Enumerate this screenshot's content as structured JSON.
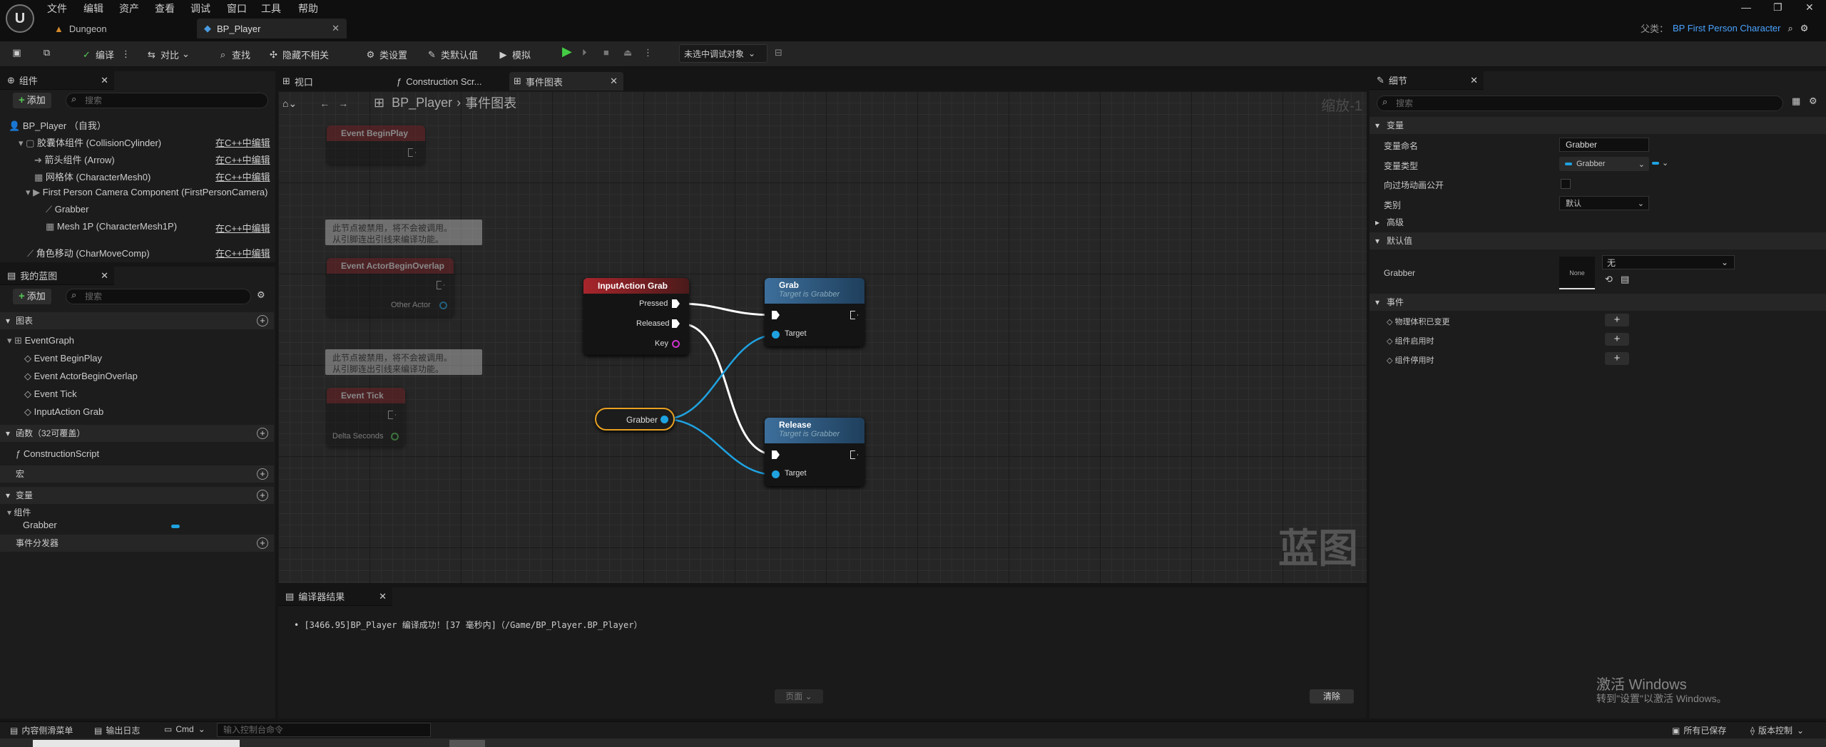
{
  "menu": [
    "文件",
    "编辑",
    "资产",
    "查看",
    "调试",
    "窗口",
    "工具",
    "帮助"
  ],
  "tabs": {
    "dungeon": "Dungeon",
    "bp_player": "BP_Player"
  },
  "parent": {
    "label": "父类：",
    "value": "BP First Person Character"
  },
  "toolbar": {
    "compile": "编译",
    "diff": "对比",
    "find": "查找",
    "hide_unrelated": "隐藏不相关",
    "class_settings": "类设置",
    "class_defaults": "类默认值",
    "simulate": "模拟",
    "debug_target": "未选中调试对象"
  },
  "components": {
    "title": "组件",
    "add": "添加",
    "search_placeholder": "搜索",
    "items": [
      {
        "label": "BP_Player （自我）",
        "edit": ""
      },
      {
        "label": "胶囊体组件 (CollisionCylinder)",
        "edit": "在C++中编辑"
      },
      {
        "label": "箭头组件 (Arrow)",
        "edit": "在C++中编辑"
      },
      {
        "label": "网格体 (CharacterMesh0)",
        "edit": "在C++中编辑"
      },
      {
        "label": "First Person Camera Component (FirstPersonCamera)",
        "edit": ""
      },
      {
        "label": "Grabber",
        "edit": ""
      },
      {
        "label": "Mesh 1P (CharacterMesh1P)",
        "edit": "在C++中编辑"
      },
      {
        "label": "角色移动 (CharMoveComp)",
        "edit": "在C++中编辑"
      }
    ]
  },
  "my_blueprint": {
    "title": "我的蓝图",
    "add": "添加",
    "search_placeholder": "搜索",
    "graphs_label": "图表",
    "event_graph": "EventGraph",
    "events": [
      "Event BeginPlay",
      "Event ActorBeginOverlap",
      "Event Tick",
      "InputAction Grab"
    ],
    "functions_label": "函数（32可覆盖）",
    "construction": "ConstructionScript",
    "macros_label": "宏",
    "variables_label": "变量",
    "components_label": "组件",
    "var_grabber": "Grabber",
    "dispatchers_label": "事件分发器"
  },
  "graph_tabs": {
    "viewport": "视口",
    "construction": "Construction Scr...",
    "event_graph": "事件图表"
  },
  "breadcrumb": {
    "bp": "BP_Player",
    "graph": "事件图表"
  },
  "zoom": "缩放-1",
  "watermark": "蓝图",
  "nodes": {
    "comment_disabled": "此节点被禁用，将不会被调用。\n从引脚连出引线来编译功能。",
    "begin_play": "Event BeginPlay",
    "begin_overlap": "Event ActorBeginOverlap",
    "other_actor": "Other Actor",
    "tick": "Event Tick",
    "delta_seconds": "Delta Seconds",
    "input_grab": "InputAction Grab",
    "pressed": "Pressed",
    "released": "Released",
    "key": "Key",
    "grab": "Grab",
    "release": "Release",
    "target_is": "Target is Grabber",
    "target": "Target",
    "grabber_var": "Grabber"
  },
  "compiler": {
    "title": "编译器结果",
    "message": "[3466.95]BP_Player 编译成功！[37 毫秒内]（/Game/BP_Player.BP_Player）",
    "page": "页面",
    "clear": "清除"
  },
  "details": {
    "title": "细节",
    "search_placeholder": "搜索",
    "variable_section": "变量",
    "var_name_label": "变量命名",
    "var_name_value": "Grabber",
    "var_type_label": "变量类型",
    "var_type_value": "Grabber",
    "expose_label": "向过场动画公开",
    "category_label": "类别",
    "category_value": "默认",
    "advanced": "高级",
    "defaults_section": "默认值",
    "grabber_label": "Grabber",
    "thumb": "None",
    "dropdown": "无",
    "events_section": "事件",
    "events": [
      "物理体积已变更",
      "组件启用时",
      "组件停用时"
    ]
  },
  "activate": {
    "line1": "激活 Windows",
    "line2": "转到\"设置\"以激活 Windows。"
  },
  "statusbar": {
    "content_drawer": "内容侧滑菜单",
    "output_log": "输出日志",
    "cmd": "Cmd",
    "cmd_placeholder": "输入控制台命令",
    "all_saved": "所有已保存",
    "source_control": "版本控制"
  },
  "colors": {
    "event_red": "#8a1f24",
    "function_blue": "#3d6f9c",
    "wire_blue": "#1fa2e0",
    "accent_green": "#47c447"
  }
}
